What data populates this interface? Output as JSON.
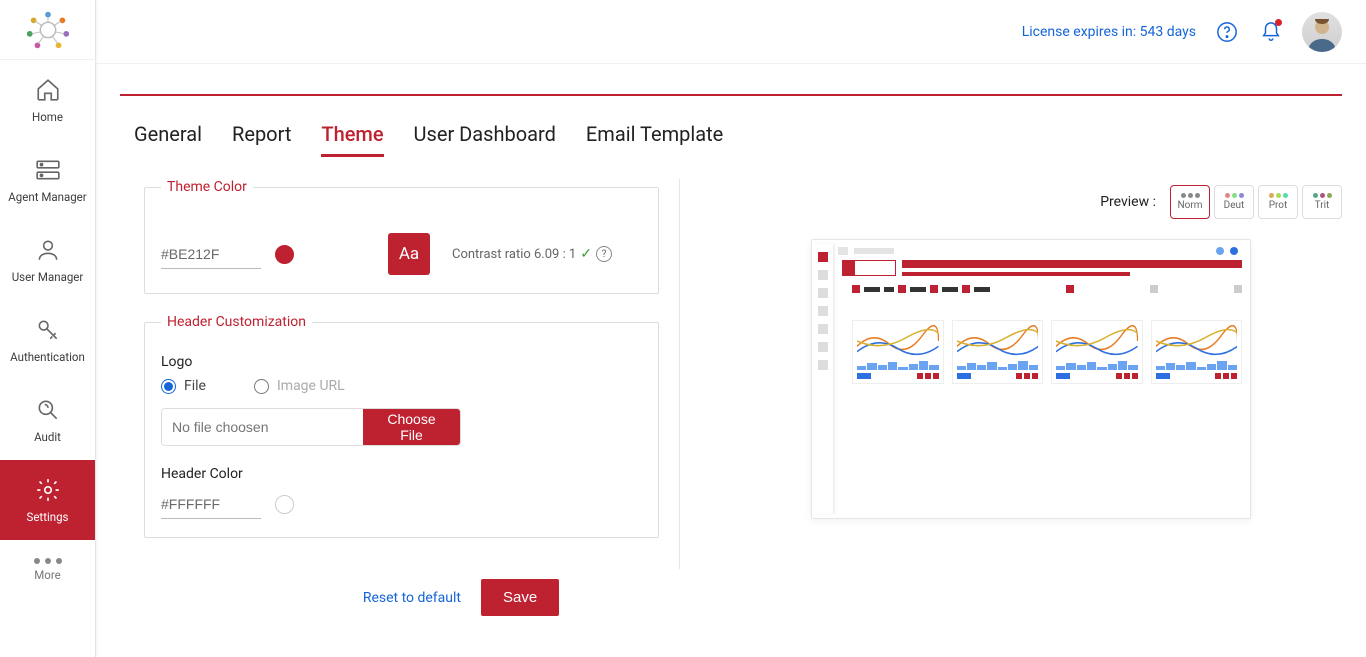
{
  "topbar": {
    "license_text": "License expires in: 543 days"
  },
  "sidebar": {
    "home": "Home",
    "agent_manager": "Agent Manager",
    "user_manager": "User Manager",
    "authentication": "Authentication",
    "audit": "Audit",
    "settings": "Settings",
    "more": "More"
  },
  "tabs": {
    "general": "General",
    "report": "Report",
    "theme": "Theme",
    "user_dashboard": "User Dashboard",
    "email_template": "Email Template"
  },
  "theme_color": {
    "legend": "Theme Color",
    "value": "#BE212F",
    "aa": "Aa",
    "contrast_text": "Contrast ratio 6.09 : 1"
  },
  "header_custom": {
    "legend": "Header Customization",
    "logo_label": "Logo",
    "radio_file": "File",
    "radio_url": "Image URL",
    "file_placeholder": "No file choosen",
    "choose_file": "Choose File",
    "header_color_label": "Header Color",
    "header_color_value": "#FFFFFF"
  },
  "actions": {
    "reset": "Reset to default",
    "save": "Save"
  },
  "preview": {
    "label": "Preview :",
    "modes": {
      "norm": "Norm",
      "deut": "Deut",
      "prot": "Prot",
      "trit": "Trit"
    }
  }
}
